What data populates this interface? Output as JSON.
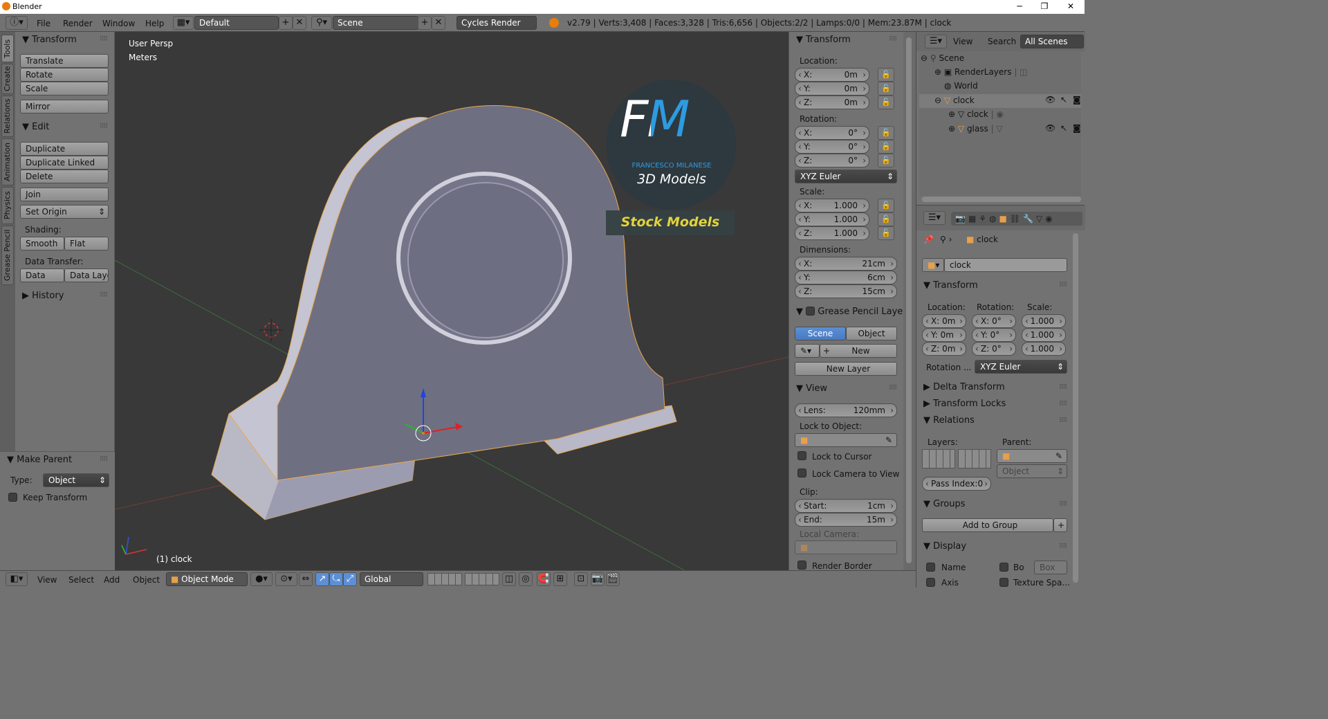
{
  "window": {
    "title": "Blender",
    "minimize": "─",
    "restore": "❐",
    "close": "✕"
  },
  "topbar": {
    "menus": [
      "File",
      "Render",
      "Window",
      "Help"
    ],
    "layout": "Default",
    "scene": "Scene",
    "engine": "Cycles Render",
    "stats": "v2.79 | Verts:3,408 | Faces:3,328 | Tris:6,656 | Objects:2/2 | Lamps:0/0 | Mem:23.87M | clock"
  },
  "tabs": [
    "Tools",
    "Create",
    "Relations",
    "Animation",
    "Physics",
    "Grease Pencil"
  ],
  "tools": {
    "transform_title": "Transform",
    "translate": "Translate",
    "rotate": "Rotate",
    "scale": "Scale",
    "mirror": "Mirror",
    "edit_title": "Edit",
    "duplicate": "Duplicate",
    "duplicate_linked": "Duplicate Linked",
    "delete": "Delete",
    "join": "Join",
    "set_origin": "Set Origin",
    "shading": "Shading:",
    "smooth": "Smooth",
    "flat": "Flat",
    "data_transfer": "Data Transfer:",
    "data": "Data",
    "data_layo": "Data Layo",
    "history": "History"
  },
  "operator": {
    "title": "Make Parent",
    "type_label": "Type:",
    "type_value": "Object",
    "keep_transform": "Keep Transform"
  },
  "viewport": {
    "view_name": "User Persp",
    "units": "Meters",
    "object_label": "(1) clock",
    "watermark_big": "FM",
    "watermark_name": "FRANCESCO MILANESE",
    "watermark_sub": "3D Models",
    "watermark_stock": "Stock Models"
  },
  "npanel": {
    "transform_title": "Transform",
    "location": "Location:",
    "rotation": "Rotation:",
    "scale": "Scale:",
    "dimensions": "Dimensions:",
    "loc": [
      {
        "l": "X:",
        "v": "0m"
      },
      {
        "l": "Y:",
        "v": "0m"
      },
      {
        "l": "Z:",
        "v": "0m"
      }
    ],
    "rot": [
      {
        "l": "X:",
        "v": "0°"
      },
      {
        "l": "Y:",
        "v": "0°"
      },
      {
        "l": "Z:",
        "v": "0°"
      }
    ],
    "rot_mode": "XYZ Euler",
    "scl": [
      {
        "l": "X:",
        "v": "1.000"
      },
      {
        "l": "Y:",
        "v": "1.000"
      },
      {
        "l": "Z:",
        "v": "1.000"
      }
    ],
    "dim": [
      {
        "l": "X:",
        "v": "21cm"
      },
      {
        "l": "Y:",
        "v": "6cm"
      },
      {
        "l": "Z:",
        "v": "15cm"
      }
    ],
    "gp_title": "Grease Pencil Layer",
    "gp_scene": "Scene",
    "gp_object": "Object",
    "gp_new": "New",
    "gp_new_layer": "New Layer",
    "view_title": "View",
    "lens_l": "Lens:",
    "lens_v": "120mm",
    "lock_obj": "Lock to Object:",
    "lock_cursor": "Lock to Cursor",
    "lock_camera": "Lock Camera to View",
    "clip": "Clip:",
    "clip_start_l": "Start:",
    "clip_start_v": "1cm",
    "clip_end_l": "End:",
    "clip_end_v": "15m",
    "local_camera": "Local Camera:",
    "render_border": "Render Border"
  },
  "outliner": {
    "view": "View",
    "search": "Search",
    "all_scenes": "All Scenes",
    "items": [
      "Scene",
      "RenderLayers",
      "World",
      "clock",
      "clock",
      "glass"
    ]
  },
  "properties": {
    "breadcrumb": "clock",
    "object_name": "clock",
    "transform_title": "Transform",
    "location": "Location:",
    "rotation": "Rotation:",
    "scale": "Scale:",
    "loc": [
      "X: 0m",
      "Y: 0m",
      "Z: 0m"
    ],
    "rot": [
      "X:  0°",
      "Y:  0°",
      "Z:  0°"
    ],
    "scl": [
      "1.000",
      "1.000",
      "1.000"
    ],
    "rot_mode_l": "Rotation ...",
    "rot_mode_v": "XYZ Euler",
    "delta": "Delta Transform",
    "locks": "Transform Locks",
    "relations": "Relations",
    "layers": "Layers:",
    "parent": "Parent:",
    "parent_type": "Object",
    "pass_index": "Pass Index:0",
    "groups": "Groups",
    "add_to_group": "Add to Group",
    "display": "Display",
    "name": "Name",
    "bo": "Bo",
    "box": "Box",
    "axis": "Axis",
    "texture_space": "Texture Spa..."
  },
  "bottombar": {
    "view": "View",
    "select": "Select",
    "add": "Add",
    "object": "Object",
    "mode": "Object Mode",
    "orientation": "Global"
  }
}
